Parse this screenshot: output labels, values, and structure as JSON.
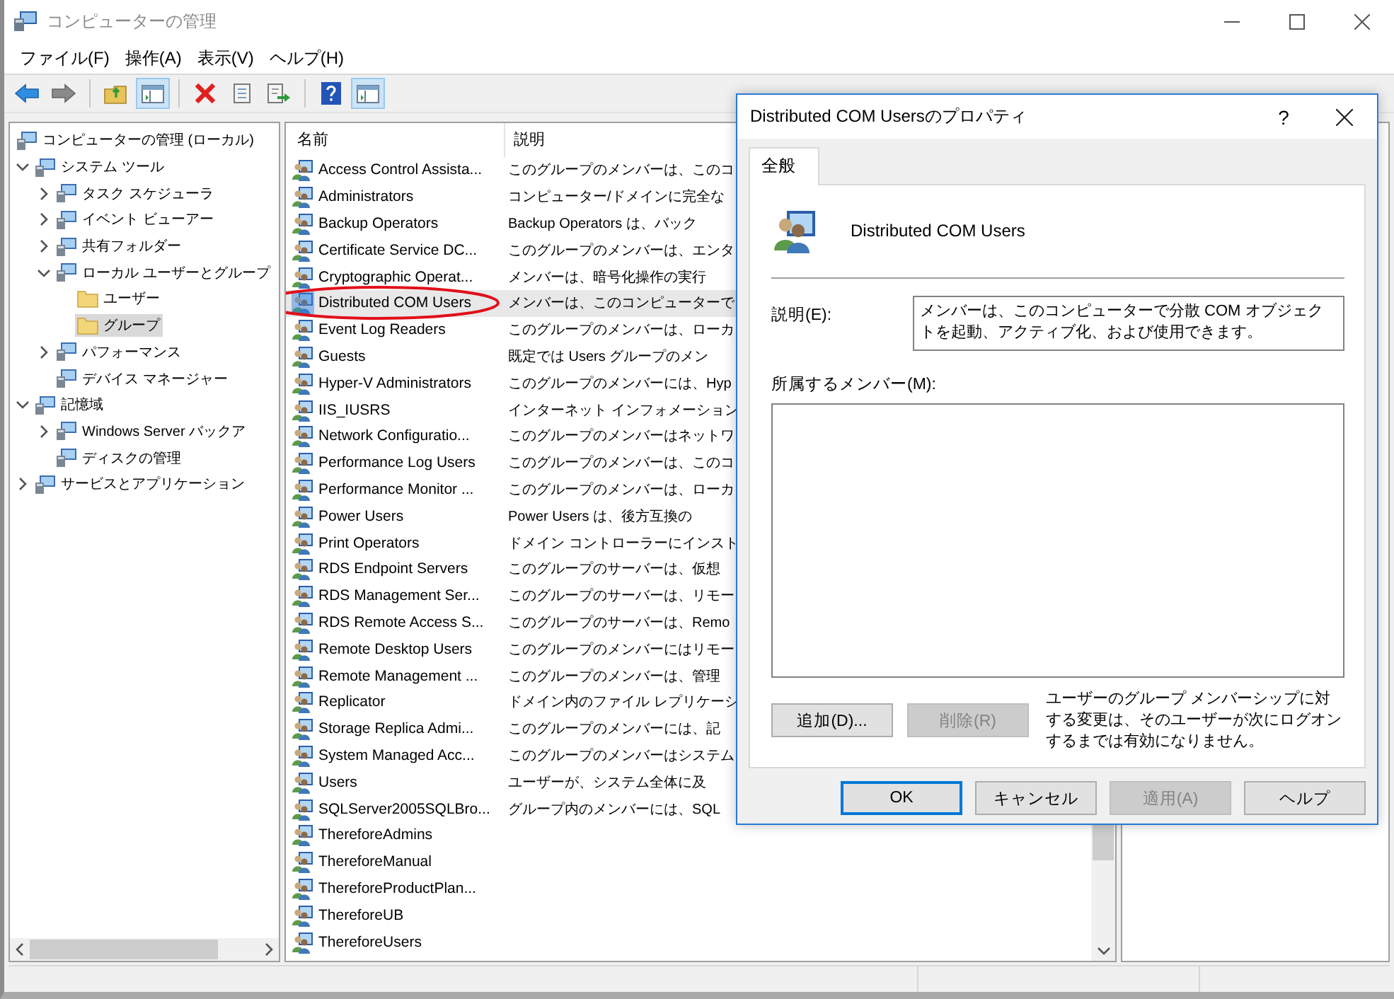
{
  "window": {
    "title": "コンピューターの管理"
  },
  "menu": [
    "ファイル(F)",
    "操作(A)",
    "表示(V)",
    "ヘルプ(H)"
  ],
  "toolbar": [
    [
      {
        "pressed": false
      },
      {
        "pressed": false
      }
    ],
    [
      {
        "pressed": false
      },
      {
        "pressed": true
      }
    ],
    [
      {
        "pressed": false
      },
      {
        "pressed": false
      },
      {
        "pressed": false
      }
    ],
    [
      {
        "pressed": false
      },
      {
        "pressed": true
      }
    ]
  ],
  "tree": [
    {
      "label": "コンピューターの管理 (ローカル)",
      "selected": false,
      "children": [
        {
          "label": "システム ツール",
          "selected": false,
          "expanded": true,
          "children": [
            {
              "label": "タスク スケジューラ",
              "selected": false,
              "expanded": false
            },
            {
              "label": "イベント ビューアー",
              "selected": false,
              "expanded": false
            },
            {
              "label": "共有フォルダー",
              "selected": false,
              "expanded": false
            },
            {
              "label": "ローカル ユーザーとグループ",
              "selected": false,
              "expanded": true,
              "children": [
                {
                  "label": "ユーザー",
                  "selected": false
                },
                {
                  "label": "グループ",
                  "selected": true
                }
              ]
            },
            {
              "label": "パフォーマンス",
              "selected": false,
              "expanded": false
            },
            {
              "label": "デバイス マネージャー",
              "selected": false
            }
          ]
        },
        {
          "label": "記憶域",
          "selected": false,
          "expanded": true,
          "children": [
            {
              "label": "Windows Server バックア",
              "selected": false,
              "expanded": false
            },
            {
              "label": "ディスクの管理",
              "selected": false
            }
          ]
        },
        {
          "label": "サービスとアプリケーション",
          "selected": false,
          "expanded": false
        }
      ]
    }
  ],
  "list": {
    "columns": [
      "名前",
      "説明"
    ],
    "rows": [
      {
        "name": "Access Control Assista...",
        "description": "このグループのメンバーは、このコ",
        "selected": false,
        "circled": false
      },
      {
        "name": "Administrators",
        "description": "コンピューター/ドメインに完全な",
        "selected": false,
        "circled": false
      },
      {
        "name": "Backup Operators",
        "description": "Backup Operators は、バック",
        "selected": false,
        "circled": false
      },
      {
        "name": "Certificate Service DC...",
        "description": "このグループのメンバーは、エンタ",
        "selected": false,
        "circled": false
      },
      {
        "name": "Cryptographic Operat...",
        "description": "メンバーは、暗号化操作の実行",
        "selected": false,
        "circled": false
      },
      {
        "name": "Distributed COM Users",
        "description": "メンバーは、このコンピューターで",
        "selected": true,
        "circled": true
      },
      {
        "name": "Event Log Readers",
        "description": "このグループのメンバーは、ローカ",
        "selected": false,
        "circled": false
      },
      {
        "name": "Guests",
        "description": "既定では Users グループのメン",
        "selected": false,
        "circled": false
      },
      {
        "name": "Hyper-V Administrators",
        "description": "このグループのメンバーには、Hyp",
        "selected": false,
        "circled": false
      },
      {
        "name": "IIS_IUSRS",
        "description": "インターネット インフォメーション",
        "selected": false,
        "circled": false
      },
      {
        "name": "Network Configuratio...",
        "description": "このグループのメンバーはネットワ",
        "selected": false,
        "circled": false
      },
      {
        "name": "Performance Log Users",
        "description": "このグループのメンバーは、このコ",
        "selected": false,
        "circled": false
      },
      {
        "name": "Performance Monitor ...",
        "description": "このグループのメンバーは、ローカ",
        "selected": false,
        "circled": false
      },
      {
        "name": "Power Users",
        "description": "Power Users は、後方互換の",
        "selected": false,
        "circled": false
      },
      {
        "name": "Print Operators",
        "description": "ドメイン コントローラーにインスト",
        "selected": false,
        "circled": false
      },
      {
        "name": "RDS Endpoint Servers",
        "description": "このグループのサーバーは、仮想",
        "selected": false,
        "circled": false
      },
      {
        "name": "RDS Management Ser...",
        "description": "このグループのサーバーは、リモー",
        "selected": false,
        "circled": false
      },
      {
        "name": "RDS Remote Access S...",
        "description": "このグループのサーバーは、Remo",
        "selected": false,
        "circled": false
      },
      {
        "name": "Remote Desktop Users",
        "description": "このグループのメンバーにはリモー",
        "selected": false,
        "circled": false
      },
      {
        "name": "Remote Management ...",
        "description": "このグループのメンバーは、管理",
        "selected": false,
        "circled": false
      },
      {
        "name": "Replicator",
        "description": "ドメイン内のファイル レプリケーシ",
        "selected": false,
        "circled": false
      },
      {
        "name": "Storage Replica Admi...",
        "description": "このグループのメンバーには、記",
        "selected": false,
        "circled": false
      },
      {
        "name": "System Managed Acc...",
        "description": "このグループのメンバーはシステム",
        "selected": false,
        "circled": false
      },
      {
        "name": "Users",
        "description": "ユーザーが、システム全体に及",
        "selected": false,
        "circled": false
      },
      {
        "name": "SQLServer2005SQLBro...",
        "description": "グループ内のメンバーには、SQL",
        "selected": false,
        "circled": false
      },
      {
        "name": "ThereforeAdmins",
        "selected": false,
        "circled": false
      },
      {
        "name": "ThereforeManual",
        "selected": false,
        "circled": false
      },
      {
        "name": "ThereforeProductPlan...",
        "selected": false,
        "circled": false
      },
      {
        "name": "ThereforeUB",
        "selected": false,
        "circled": false
      },
      {
        "name": "ThereforeUsers",
        "selected": false,
        "circled": false
      }
    ]
  },
  "dialog": {
    "title": "Distributed COM Usersのプロパティ",
    "help_glyph": "?",
    "tabs": [
      {
        "label": "全般",
        "selected": true
      }
    ],
    "group_name": "Distributed COM Users",
    "description_label": "説明(E):",
    "description": "メンバーは、このコンピューターで分散 COM オブジェクトを起動、アクティブ化、および使用できます。",
    "members_label": "所属するメンバー(M):",
    "member_buttons": [
      {
        "label": "追加(D)...",
        "disabled": false
      },
      {
        "label": "削除(R)",
        "disabled": true
      }
    ],
    "note": "ユーザーのグループ メンバーシップに対する変更は、そのユーザーが次にログオンするまでは有効になりません。",
    "buttons": [
      {
        "label": "OK",
        "disabled": false,
        "focused": true
      },
      {
        "label": "キャンセル",
        "disabled": false,
        "focused": false
      },
      {
        "label": "適用(A)",
        "disabled": true,
        "focused": false
      },
      {
        "label": "ヘルプ",
        "disabled": false,
        "focused": false
      }
    ]
  }
}
